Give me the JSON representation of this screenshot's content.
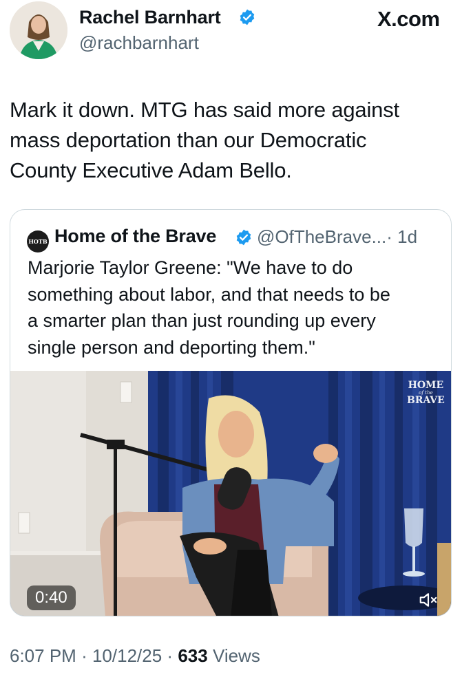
{
  "brand": {
    "label": "X.com"
  },
  "author": {
    "name": "Rachel Barnhart",
    "handle": "@rachbarnhart",
    "verified": true
  },
  "tweet": {
    "text": "Mark it down. MTG has said more against\nmass deportation than our Democratic\nCounty Executive Adam Bello."
  },
  "quote": {
    "avatar_text": "HOTB",
    "name": "Home of the Brave",
    "handle": "@OfTheBrave...",
    "time": "· 1d",
    "text": "Marjorie Taylor Greene: \"We have to do\nsomething about labor, and that needs to be\na smarter plan than just rounding up every\nsingle person and deporting them.\"",
    "video": {
      "duration": "0:40",
      "watermark_top": "HOME",
      "watermark_mid": "of the",
      "watermark_bottom": "BRAVE",
      "mute_icon": "volume-muted-icon"
    }
  },
  "footer": {
    "time": "6:07 PM",
    "date": "10/12/25",
    "views_count": "633",
    "views_label": "Views",
    "sep": "·"
  },
  "colors": {
    "verified": "#1d9bf0",
    "secondary_text": "#536471",
    "border": "#cfd9de"
  }
}
